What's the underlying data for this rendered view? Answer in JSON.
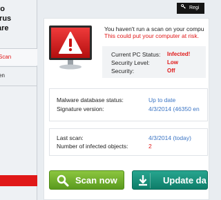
{
  "app": {
    "logo_lines": [
      "ro",
      "irus",
      "are"
    ]
  },
  "sidebar": {
    "items": [
      {
        "label": "Scan",
        "active": true
      },
      {
        "label": "en",
        "active": false
      }
    ]
  },
  "header": {
    "register_label": "Regi",
    "register_icon": "key-icon"
  },
  "alert": {
    "icon": "warning-icon",
    "line1": "You haven't run a scan on your compu",
    "line2": "This could put your computer at risk."
  },
  "status": {
    "rows": [
      {
        "label": "Current PC Status:",
        "value": "Infected!"
      },
      {
        "label": "Security Level:",
        "value": "Low"
      },
      {
        "label": "Security:",
        "value": "Off"
      }
    ]
  },
  "database": {
    "rows": [
      {
        "label": "Malware database status:",
        "value": "Up to date"
      },
      {
        "label": "Signature version:",
        "value": "4/3/2014 (46350 en"
      }
    ]
  },
  "scan_info": {
    "rows": [
      {
        "label": "Last scan:",
        "value": "4/3/2014 (today)"
      },
      {
        "label": "Number of infected objects:",
        "value": "2"
      }
    ]
  },
  "buttons": {
    "scan_label": "Scan now",
    "update_label": "Update da"
  },
  "colors": {
    "alert_red": "#e01818",
    "link_blue": "#3a74c4",
    "scan_green": "#6fae2a",
    "update_teal": "#16907a"
  }
}
